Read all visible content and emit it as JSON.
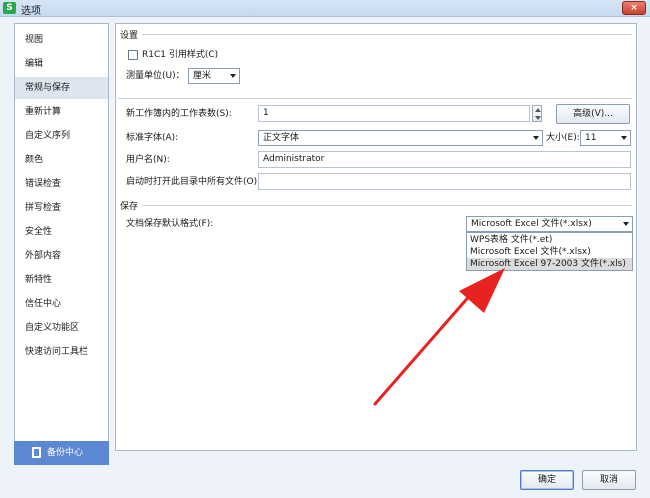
{
  "window": {
    "title": "选项",
    "app_icon_letter": "S",
    "close_label": "×"
  },
  "sidebar": {
    "items": [
      {
        "label": "视图"
      },
      {
        "label": "编辑"
      },
      {
        "label": "常规与保存",
        "active": true
      },
      {
        "label": "重新计算"
      },
      {
        "label": "自定义序列"
      },
      {
        "label": "颜色"
      },
      {
        "label": "错误检查"
      },
      {
        "label": "拼写检查"
      },
      {
        "label": "安全性"
      },
      {
        "label": "外部内容"
      },
      {
        "label": "新特性"
      },
      {
        "label": "信任中心"
      },
      {
        "label": "自定义功能区"
      },
      {
        "label": "快速访问工具栏"
      }
    ],
    "backup_label": "备份中心"
  },
  "settings": {
    "section_title": "设置",
    "r1c1_label": "R1C1 引用样式(C)",
    "r1c1_checked": false,
    "unit_label": "测量单位(U)：",
    "unit_value": "厘米",
    "sheets_label": "新工作簿内的工作表数(S):",
    "sheets_value": "1",
    "advanced_label": "高级(V)...",
    "font_label": "标准字体(A):",
    "font_value": "正文字体",
    "size_label": "大小(E):",
    "size_value": "11",
    "username_label": "用户名(N):",
    "username_value": "Administrator",
    "startup_label": "启动时打开此目录中所有文件(O):",
    "startup_value": ""
  },
  "save": {
    "section_title": "保存",
    "format_label": "文档保存默认格式(F):",
    "format_value": "Microsoft Excel 文件(*.xlsx)",
    "options": [
      {
        "label": "WPS表格 文件(*.et)"
      },
      {
        "label": "Microsoft Excel 文件(*.xlsx)"
      },
      {
        "label": "Microsoft Excel 97-2003 文件(*.xls)",
        "highlighted": true
      }
    ]
  },
  "footer": {
    "ok_label": "确定",
    "cancel_label": "取消"
  },
  "colors": {
    "accent": "#5b87d3",
    "annotation_arrow": "#e8231f"
  }
}
